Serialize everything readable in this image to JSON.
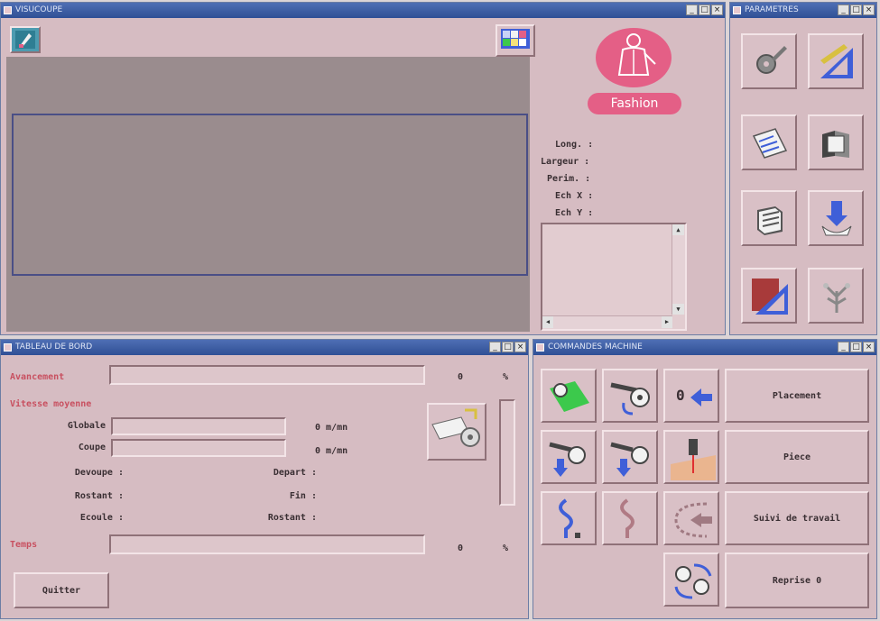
{
  "main_window": {
    "title": "VISUCOUPE",
    "logo_text": "Fashion",
    "info_labels": [
      "Long. :",
      "Largeur :",
      "Perim. :",
      "Ech X :",
      "Ech Y :"
    ]
  },
  "tools_window": {
    "title": "PARAMETRES",
    "buttons": [
      "settings-tool",
      "measure-tool",
      "tags-tool",
      "folders-tool",
      "material-stack-tool",
      "download-tool",
      "edit-ruler-tool",
      "tree-tool"
    ]
  },
  "progress_window": {
    "title": "TABLEAU DE BORD",
    "avancement_label": "Avancement",
    "avancement_value": "0",
    "avancement_unit": "%",
    "vitesse_label": "Vitesse moyenne",
    "globale_label": "Globale",
    "globale_value": "0 m/mn",
    "coupe_label": "Coupe",
    "coupe_value": "0 m/mn",
    "devenue_label": "Devoupe :",
    "restant_label": "Rostant :",
    "ecoule_label": "Ecoule :",
    "depart_label": "Depart :",
    "fin_label": "Fin :",
    "restant2_label": "Rostant :",
    "temps_label": "Temps",
    "temps_value": "0",
    "temps_unit": "%",
    "quit_label": "Quitter"
  },
  "commands_window": {
    "title": "COMMANDES MACHINE",
    "zero_label": "0",
    "placement_label": "Placement",
    "piece_label": "Piece",
    "suivi_label": "Suivi de travail",
    "reprise_label": "Reprise 0"
  },
  "colors": {
    "titlebar": "#3d5da4",
    "panel": "#d6bcc2",
    "canvas": "#9a8c8e",
    "logo": "#e45f86",
    "accent_blue": "#3f5fd8",
    "accent_green": "#3cc94c"
  }
}
